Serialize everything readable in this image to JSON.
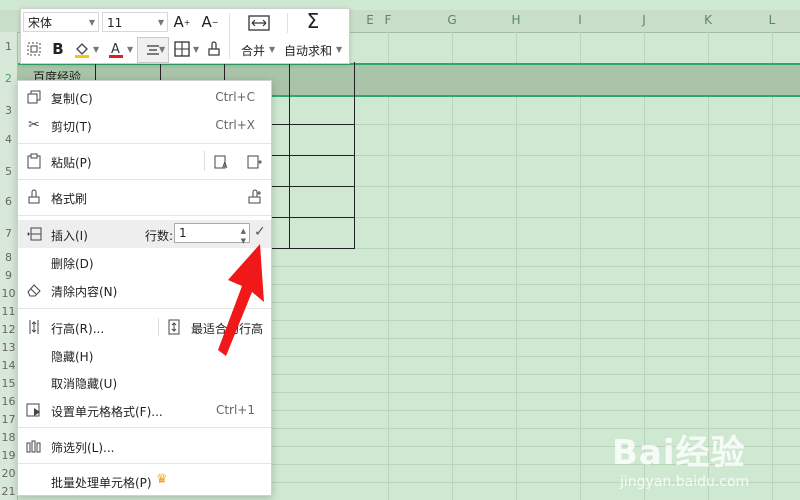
{
  "sheet": {
    "columns": [
      "E",
      "F",
      "G",
      "H",
      "I",
      "J",
      "K",
      "L"
    ],
    "rows": [
      "1",
      "2",
      "3",
      "4",
      "5",
      "6",
      "7",
      "8",
      "9",
      "10",
      "11",
      "12",
      "13",
      "14",
      "15",
      "16",
      "17",
      "18",
      "19",
      "20",
      "21"
    ],
    "cell_b2_text": "百度经验"
  },
  "toolbar": {
    "font_name": "宋体",
    "font_size": "11",
    "merge_label": "合并",
    "autosum_label": "自动求和",
    "colors": {
      "font_color": "#e02020",
      "fill_color": "#f5c518"
    }
  },
  "context_menu": {
    "items": [
      {
        "label": "复制(C)",
        "shortcut": "Ctrl+C",
        "icon": "copy-icon"
      },
      {
        "label": "剪切(T)",
        "shortcut": "Ctrl+X",
        "icon": "scissors-icon"
      },
      {
        "label": "粘贴(P)",
        "icon": "paste-icon"
      },
      {
        "label": "格式刷",
        "icon": "format-brush-icon"
      },
      {
        "label": "插入(I)",
        "icon": "insert-row-icon"
      },
      {
        "label": "删除(D)"
      },
      {
        "label": "清除内容(N)",
        "icon": "eraser-icon"
      },
      {
        "label": "行高(R)...",
        "icon": "row-height-icon"
      },
      {
        "label": "隐藏(H)"
      },
      {
        "label": "取消隐藏(U)"
      },
      {
        "label": "设置单元格格式(F)...",
        "shortcut": "Ctrl+1",
        "icon": "format-cells-icon"
      },
      {
        "label": "筛选列(L)...",
        "icon": "filter-columns-icon"
      },
      {
        "label": "批量处理单元格(P)",
        "icon": "crown-icon"
      }
    ],
    "insert_rows_label": "行数:",
    "insert_rows_value": "1",
    "best_fit_label": "最适合的行高",
    "colors": {
      "highlight": "#eeeeee",
      "crown": "#f0a020"
    }
  },
  "annotation": {
    "arrow_color": "#f01818"
  },
  "watermark": {
    "brand": "Bai经验",
    "url": "jingyan.baidu.com"
  }
}
